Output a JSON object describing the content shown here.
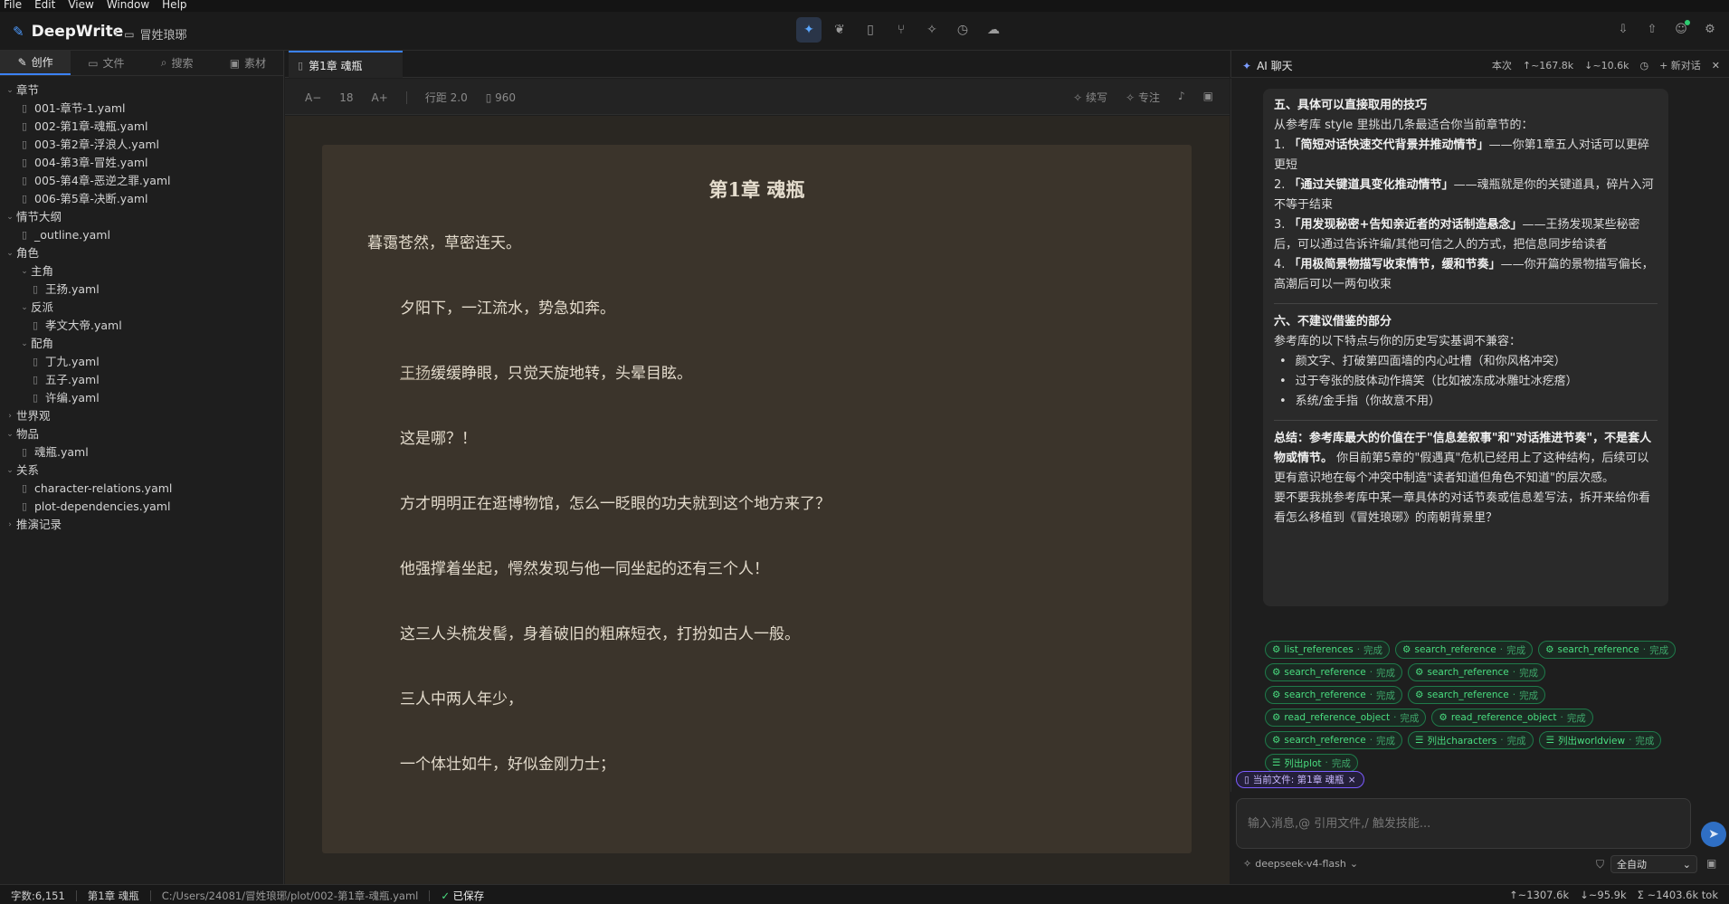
{
  "menu": [
    "File",
    "Edit",
    "View",
    "Window",
    "Help"
  ],
  "app": {
    "name": "DeepWrite",
    "project": "冒姓琅琊"
  },
  "left_tabs": [
    "创作",
    "文件",
    "搜索",
    "素材"
  ],
  "tree": [
    {
      "depth": 0,
      "kind": "folder",
      "label": "章节",
      "open": true
    },
    {
      "depth": 1,
      "kind": "file",
      "label": "001-章节-1.yaml"
    },
    {
      "depth": 1,
      "kind": "file",
      "label": "002-第1章-魂瓶.yaml"
    },
    {
      "depth": 1,
      "kind": "file",
      "label": "003-第2章-浮浪人.yaml"
    },
    {
      "depth": 1,
      "kind": "file",
      "label": "004-第3章-冒姓.yaml"
    },
    {
      "depth": 1,
      "kind": "file",
      "label": "005-第4章-恶逆之罪.yaml"
    },
    {
      "depth": 1,
      "kind": "file",
      "label": "006-第5章-决断.yaml"
    },
    {
      "depth": 0,
      "kind": "folder",
      "label": "情节大纲",
      "open": true
    },
    {
      "depth": 1,
      "kind": "file",
      "label": "_outline.yaml"
    },
    {
      "depth": 0,
      "kind": "folder",
      "label": "角色",
      "open": true
    },
    {
      "depth": 1,
      "kind": "folder",
      "label": "主角",
      "open": true
    },
    {
      "depth": 2,
      "kind": "file",
      "label": "王扬.yaml"
    },
    {
      "depth": 1,
      "kind": "folder",
      "label": "反派",
      "open": true
    },
    {
      "depth": 2,
      "kind": "file",
      "label": "孝文大帝.yaml"
    },
    {
      "depth": 1,
      "kind": "folder",
      "label": "配角",
      "open": true
    },
    {
      "depth": 2,
      "kind": "file",
      "label": "丁九.yaml"
    },
    {
      "depth": 2,
      "kind": "file",
      "label": "五子.yaml"
    },
    {
      "depth": 2,
      "kind": "file",
      "label": "许编.yaml"
    },
    {
      "depth": 0,
      "kind": "folder",
      "label": "世界观",
      "open": false
    },
    {
      "depth": 0,
      "kind": "folder",
      "label": "物品",
      "open": true
    },
    {
      "depth": 1,
      "kind": "file",
      "label": "魂瓶.yaml"
    },
    {
      "depth": 0,
      "kind": "folder",
      "label": "关系",
      "open": true
    },
    {
      "depth": 1,
      "kind": "file",
      "label": "character-relations.yaml"
    },
    {
      "depth": 1,
      "kind": "file",
      "label": "plot-dependencies.yaml"
    },
    {
      "depth": 0,
      "kind": "folder",
      "label": "推演记录",
      "open": false
    }
  ],
  "editor": {
    "tab_label": "第1章 魂瓶",
    "font_decrease": "A−",
    "font_size": "18",
    "font_increase": "A+",
    "line_height": "行距 2.0",
    "width": "960",
    "continue_label": "续写",
    "focus_label": "专注",
    "doc_title": "第1章 魂瓶",
    "first_line": "暮霭苍然，草密连天。",
    "name_mention": "王扬",
    "after_mention": "缓缓睁眼，只觉天旋地转，头晕目眩。",
    "paragraphs": [
      "夕阳下，一江流水，势急如奔。",
      "这是哪？！",
      "方才明明正在逛博物馆，怎么一眨眼的功夫就到这个地方来了？",
      "他强撑着坐起，愕然发现与他一同坐起的还有三个人！",
      "这三人头梳发髻，身着破旧的粗麻短衣，打扮如古人一般。",
      "三人中两人年少，",
      "一个体壮如牛，好似金刚力士；"
    ]
  },
  "ai": {
    "title": "AI 聊天",
    "stats_label": "本次",
    "stat_up": "↑~167.8k",
    "stat_down": "↓~10.6k",
    "new_chat": "+ 新对话",
    "sec5_title": "五、具体可以直接取用的技巧",
    "sec5_intro": "从参考库 style 里挑出几条最适合你当前章节的：",
    "tips": [
      {
        "no": "1.",
        "bold": "「简短对话快速交代背景并推动情节」",
        "rest": "——你第1章五人对话可以更碎更短"
      },
      {
        "no": "2.",
        "bold": "「通过关键道具变化推动情节」",
        "rest": "——魂瓶就是你的关键道具，碎片入河不等于结束"
      },
      {
        "no": "3.",
        "bold": "「用发现秘密+告知亲近者的对话制造悬念」",
        "rest": "——王扬发现某些秘密后，可以通过告诉许编/其他可信之人的方式，把信息同步给读者"
      },
      {
        "no": "4.",
        "bold": "「用极简景物描写收束情节，缓和节奏」",
        "rest": "——你开篇的景物描写偏长，高潮后可以一两句收束"
      }
    ],
    "sec6_title": "六、不建议借鉴的部分",
    "sec6_intro": "参考库的以下特点与你的历史写实基调不兼容：",
    "not_recommended": [
      "颜文字、打破第四面墙的内心吐槽（和你风格冲突）",
      "过于夸张的肢体动作搞笑（比如被冻成冰雕吐冰疙瘩）",
      "系统/金手指（你故意不用）"
    ],
    "summary_bold": "总结：参考库最大的价值在于\"信息差叙事\"和\"对话推进节奏\"，不是套人物或情节。",
    "summary_rest": "你目前第5章的\"假遇真\"危机已经用上了这种结构，后续可以更有意识地在每个冲突中制造\"读者知道但角色不知道\"的层次感。",
    "closing": "要不要我挑参考库中某一章具体的对话节奏或信息差写法，拆开来给你看看怎么移植到《冒姓琅琊》的南朝背景里？",
    "tool_calls": [
      {
        "icon": "gear",
        "name": "list_references",
        "status": "完成"
      },
      {
        "icon": "gear",
        "name": "search_reference",
        "status": "完成"
      },
      {
        "icon": "gear",
        "name": "search_reference",
        "status": "完成"
      },
      {
        "icon": "gear",
        "name": "search_reference",
        "status": "完成"
      },
      {
        "icon": "gear",
        "name": "search_reference",
        "status": "完成"
      },
      {
        "icon": "gear",
        "name": "search_reference",
        "status": "完成"
      },
      {
        "icon": "gear",
        "name": "search_reference",
        "status": "完成"
      },
      {
        "icon": "gear",
        "name": "read_reference_object",
        "status": "完成"
      },
      {
        "icon": "gear",
        "name": "read_reference_object",
        "status": "完成"
      },
      {
        "icon": "gear",
        "name": "search_reference",
        "status": "完成"
      },
      {
        "icon": "list",
        "name": "列出characters",
        "status": "完成"
      },
      {
        "icon": "list",
        "name": "列出worldview",
        "status": "完成"
      },
      {
        "icon": "list",
        "name": "列出plot",
        "status": "完成"
      }
    ],
    "context_file": "当前文件: 第1章 魂瓶",
    "input_placeholder": "输入消息,@ 引用文件,/ 触发技能...",
    "model": "deepseek-v4-flash",
    "mode": "全自动"
  },
  "status": {
    "word_count": "字数:6,151",
    "chapter": "第1章 魂瓶",
    "path": "C:/Users/24081/冒姓琅琊/plot/002-第1章-魂瓶.yaml",
    "saved": "已保存",
    "tok_up": "↑~1307.6k",
    "tok_down": "↓~95.9k",
    "tok_total": "Σ ~1403.6k tok"
  },
  "colors": {
    "accent": "#3b82f6",
    "paper": "#3b342b",
    "chip_green": "#4ade80",
    "context_purple": "#7c5cff"
  }
}
